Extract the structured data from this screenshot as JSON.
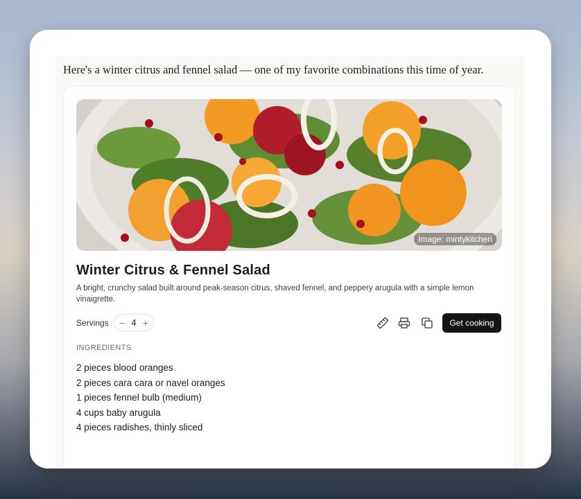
{
  "chat": {
    "message": "Here's a winter citrus and fennel salad — one of my favorite combinations this time of year."
  },
  "recipe": {
    "image_credit": "Image: mintykitchen",
    "title": "Winter Citrus & Fennel Salad",
    "description": "A bright, crunchy salad built around peak-season citrus, shaved fennel, and peppery arugula with a simple lemon vinaigrette.",
    "servings_label": "Servings",
    "servings_value": "4",
    "decrement_icon": "minus-icon",
    "increment_icon": "plus-icon",
    "actions": {
      "units_icon": "ruler-icon",
      "print_icon": "printer-icon",
      "copy_icon": "copy-icon",
      "cook_label": "Get cooking"
    },
    "ingredients_header": "INGREDIENTS",
    "ingredients": [
      "2 pieces blood oranges",
      "2 pieces cara cara or navel oranges",
      "1 pieces fennel bulb (medium)",
      "4 cups baby arugula",
      "4 pieces radishes, thinly sliced"
    ]
  },
  "colors": {
    "button_bg": "#141414",
    "card_bg": "#ffffff",
    "chat_bg": "#faf8f5"
  }
}
